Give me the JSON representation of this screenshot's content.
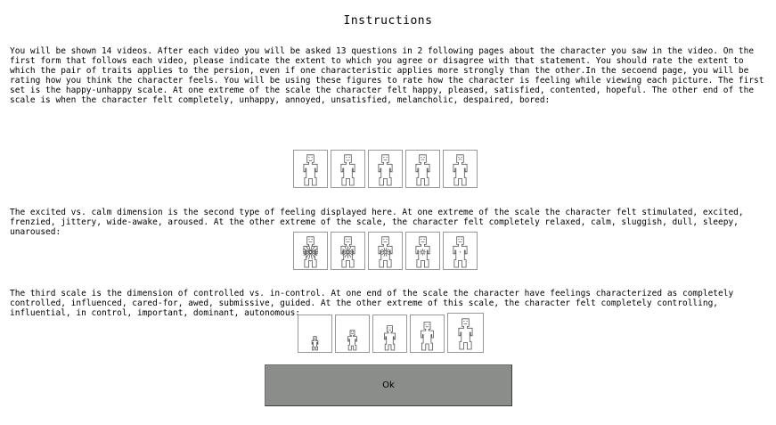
{
  "title": "Instructions",
  "paragraphs": {
    "intro": " You will be shown 14 videos. After each video you will be asked 13 questions in 2 following pages about the character you saw in the video. On the first form that follows each video, please indicate the extent to which you agree or disagree with that statement. You should rate the extent to which the pair of traits applies to the persion, even if one characteristic applies more strongly than the other.In the secoend page, you will be rating how you think the character feels. You will be using these figures to rate how the character is feeling while viewing each picture. The first set is the happy-unhappy scale. At one extreme of the scale the character felt happy, pleased, satisfied, contented, hopeful. The other end of the scale is when the character felt completely, unhappy, annoyed, unsatisfied, melancholic, despaired, bored:",
    "arousal": "The excited vs. calm dimension is the second type of feeling displayed here. At one extreme of the scale the character felt stimulated, excited, frenzied, jittery, wide-awake, aroused. At the other extreme of the scale, the character felt completely relaxed, calm, sluggish, dull, sleepy, unaroused:",
    "dominance": "The third scale is the dimension of controlled vs. in-control. At one end of the scale the character have feelings characterized as completely controlled, influenced, cared-for, awed, submissive, guided. At the other extreme of this scale, the character felt completely controlling, influential, in control, important, dominant, autonomous:"
  },
  "scales": {
    "valence": [
      "very-happy",
      "happy",
      "neutral",
      "unhappy",
      "very-unhappy"
    ],
    "arousal": [
      "very-excited",
      "excited",
      "neutral",
      "calm",
      "very-calm"
    ],
    "dominance": [
      0.45,
      0.65,
      0.8,
      0.92,
      1.0
    ]
  },
  "ok_label": "Ok"
}
